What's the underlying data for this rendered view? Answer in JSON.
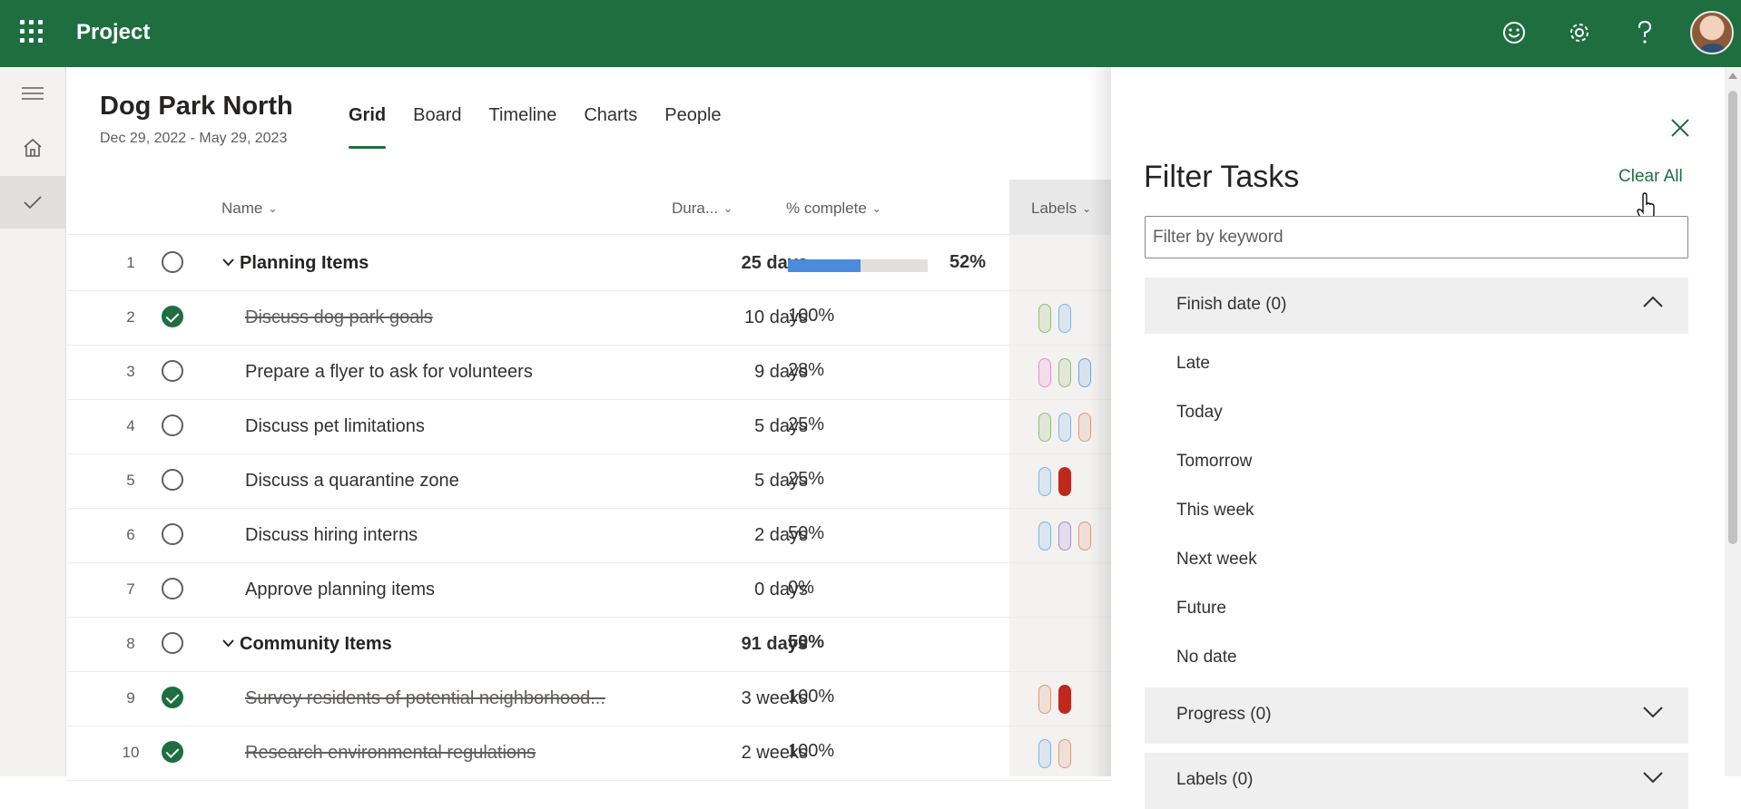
{
  "app": {
    "title": "Project"
  },
  "project": {
    "name": "Dog Park North",
    "dates": "Dec 29, 2022 - May 29, 2023"
  },
  "tabs": [
    {
      "label": "Grid",
      "active": true
    },
    {
      "label": "Board",
      "active": false
    },
    {
      "label": "Timeline",
      "active": false
    },
    {
      "label": "Charts",
      "active": false
    },
    {
      "label": "People",
      "active": false
    }
  ],
  "grid": {
    "columns": {
      "name": "Name",
      "duration": "Dura...",
      "percent": "% complete",
      "labels": "Labels"
    },
    "rows": [
      {
        "num": "1",
        "name": "Planning Items",
        "duration": "25 days",
        "percent": "52%",
        "progress": 0.52,
        "summary": true,
        "done": false,
        "labels": []
      },
      {
        "num": "2",
        "name": "Discuss dog park goals",
        "duration": "10 days",
        "percent": "100%",
        "summary": false,
        "done": true,
        "labels": [
          "#9ab97a",
          "#82b4e3"
        ]
      },
      {
        "num": "3",
        "name": "Prepare a flyer to ask for volunteers",
        "duration": "9 days",
        "percent": "28%",
        "summary": false,
        "done": false,
        "labels": [
          "#e893c8",
          "#9ab97a",
          "#6fa6da"
        ]
      },
      {
        "num": "4",
        "name": "Discuss pet limitations",
        "duration": "5 days",
        "percent": "25%",
        "summary": false,
        "done": false,
        "labels": [
          "#9ab97a",
          "#82b4e3",
          "#de9c76"
        ]
      },
      {
        "num": "5",
        "name": "Discuss a quarantine zone",
        "duration": "5 days",
        "percent": "25%",
        "summary": false,
        "done": false,
        "labels": [
          "#82b4e3",
          "#c0271d"
        ]
      },
      {
        "num": "6",
        "name": "Discuss hiring interns",
        "duration": "2 days",
        "percent": "50%",
        "summary": false,
        "done": false,
        "labels": [
          "#82b4e3",
          "#a58ed0",
          "#de9c76"
        ]
      },
      {
        "num": "7",
        "name": "Approve planning items",
        "duration": "0 days",
        "percent": "0%",
        "summary": false,
        "done": false,
        "labels": []
      },
      {
        "num": "8",
        "name": "Community Items",
        "duration": "91 days",
        "percent": "50%",
        "summary": true,
        "done": false,
        "labels": []
      },
      {
        "num": "9",
        "name": "Survey residents of potential neighborhood...",
        "duration": "3 weeks",
        "percent": "100%",
        "summary": false,
        "done": true,
        "labels": [
          "#de9c76",
          "#c0271d"
        ]
      },
      {
        "num": "10",
        "name": "Research environmental regulations",
        "duration": "2 weeks",
        "percent": "100%",
        "summary": false,
        "done": true,
        "labels": [
          "#82b4e3",
          "#de9c76"
        ]
      }
    ]
  },
  "filter": {
    "title": "Filter Tasks",
    "clear_all": "Clear All",
    "keyword_placeholder": "Filter by keyword",
    "keyword_value": "",
    "sections": {
      "finish": {
        "title": "Finish date (0)",
        "expanded": true,
        "options": [
          "Late",
          "Today",
          "Tomorrow",
          "This week",
          "Next week",
          "Future",
          "No date"
        ]
      },
      "progress": {
        "title": "Progress (0)",
        "expanded": false
      },
      "labels": {
        "title": "Labels (0)",
        "expanded": false
      }
    }
  },
  "colors": {
    "brand": "#1f6e40",
    "progress_fill": "#4a8bdb"
  },
  "icons": [
    "app-launcher-icon",
    "smiley-icon",
    "gear-icon",
    "help-icon",
    "hamburger-icon",
    "home-icon",
    "checkmark-icon",
    "close-icon",
    "chevron-up-icon",
    "chevron-down-icon"
  ]
}
